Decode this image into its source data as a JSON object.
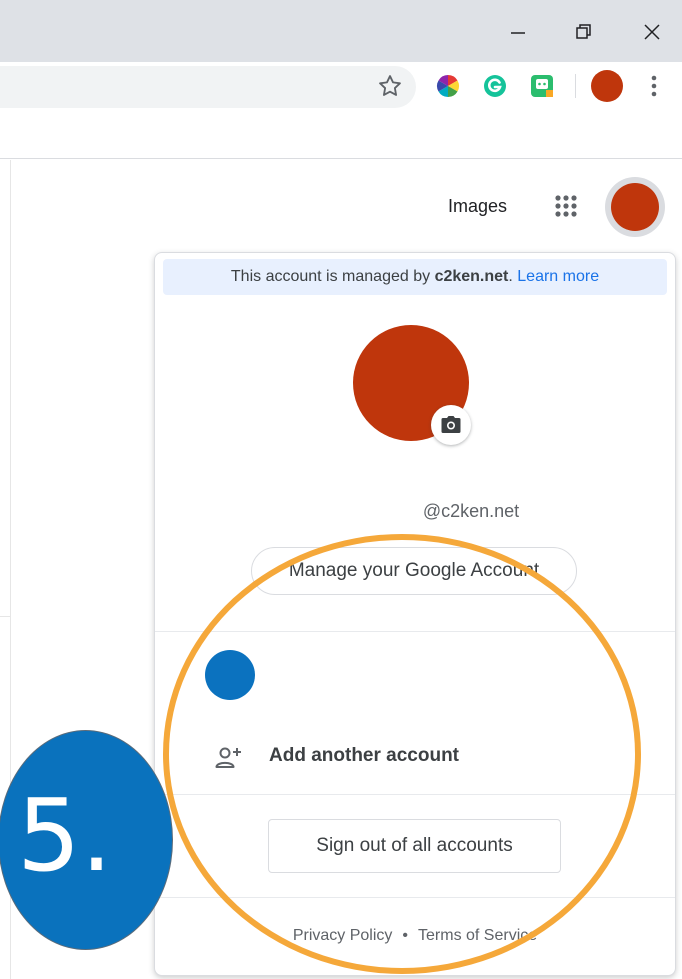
{
  "browser": {
    "window_controls": [
      "minimize-icon",
      "restore-icon",
      "close-icon"
    ],
    "toolbar_icons": [
      "bookmark-star-icon",
      "color-wheel-extension-icon",
      "grammarly-extension-icon",
      "green-extension-icon",
      "profile-avatar",
      "menu-kebab-icon"
    ],
    "avatar_color": "#bf360c"
  },
  "header": {
    "images_label": "Images",
    "apps_icon": "apps-grid-icon"
  },
  "account_popup": {
    "banner_prefix": "This account is managed by ",
    "banner_domain": "c2ken.net",
    "banner_period": ".",
    "banner_link": "Learn more",
    "email": "@c2ken.net",
    "manage_button": "Manage your Google Account",
    "add_account": "Add another account",
    "sign_out": "Sign out of all accounts",
    "privacy": "Privacy Policy",
    "separator": "•",
    "terms": "Terms of Service",
    "colors": {
      "avatar": "#bf360c",
      "other_account_avatar": "#0b72bf",
      "banner_bg": "#e8f0fe",
      "link": "#1a73e8"
    }
  },
  "annotation": {
    "step_label": "5.",
    "ring_color": "#f5a83a",
    "badge_color": "#0a72bd"
  }
}
